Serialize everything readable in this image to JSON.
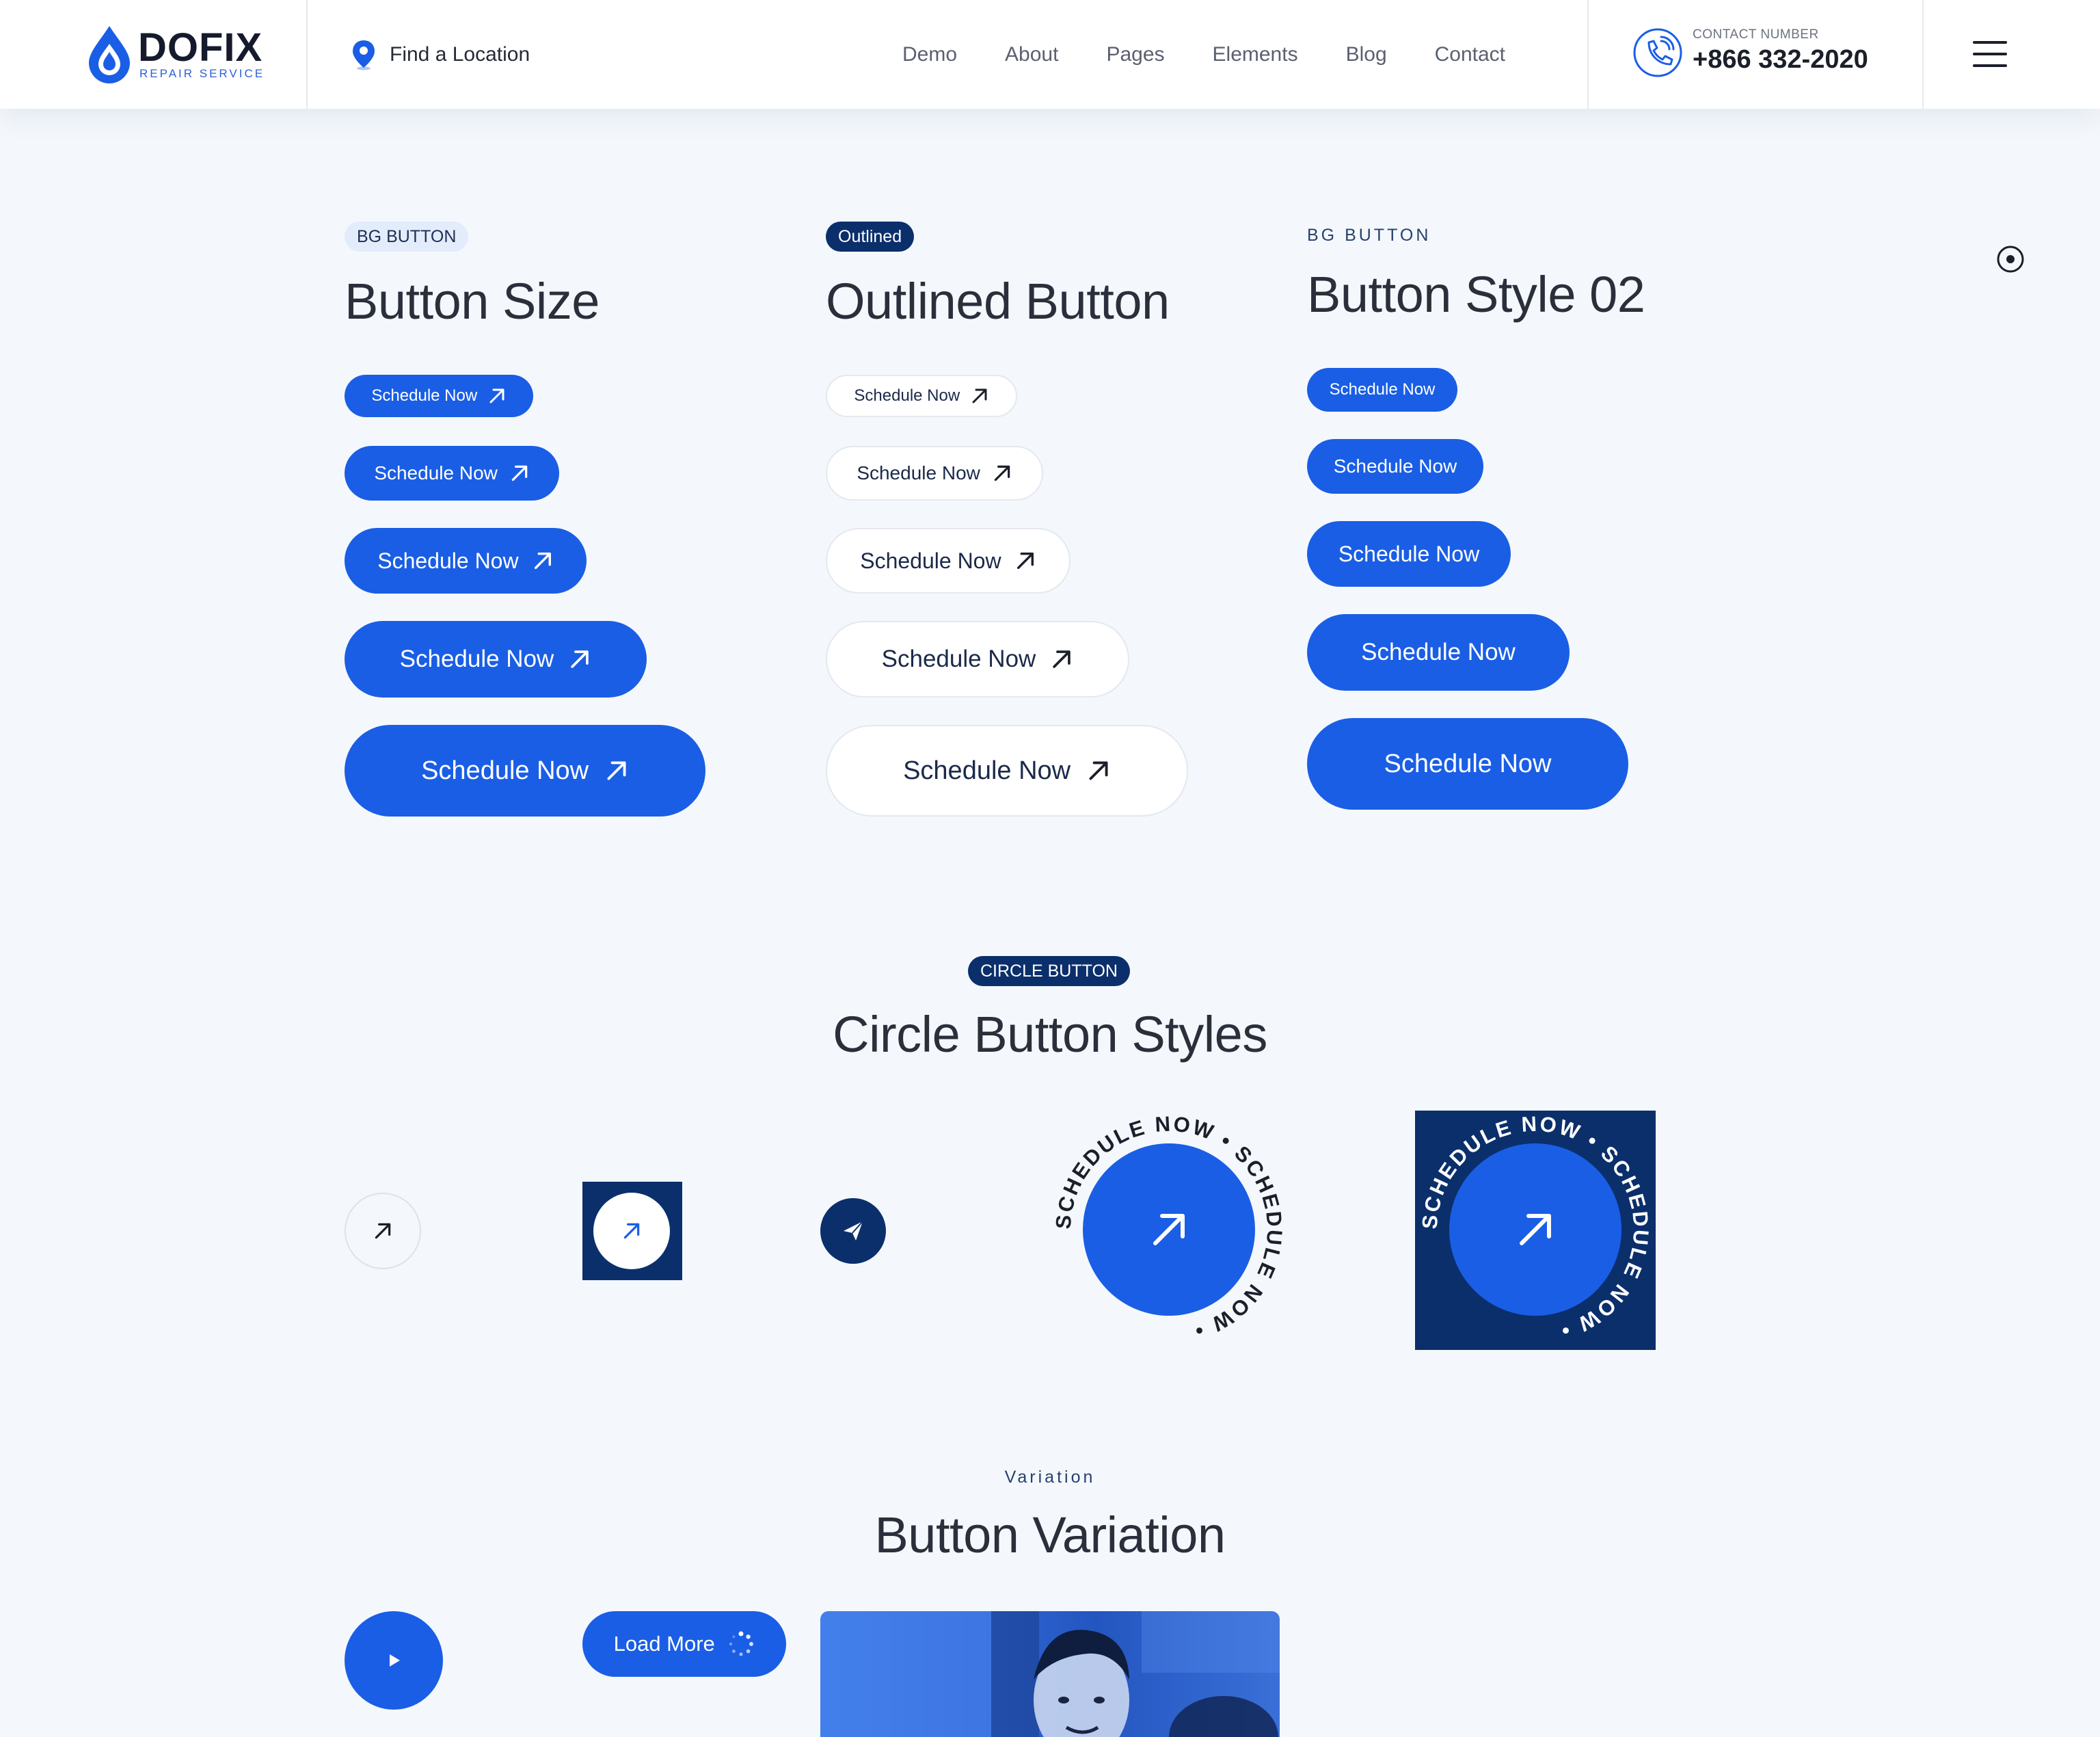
{
  "header": {
    "logo": {
      "name": "DOFIX",
      "tagline": "REPAIR SERVICE"
    },
    "location_label": "Find a Location",
    "nav": [
      "Demo",
      "About",
      "Pages",
      "Elements",
      "Blog",
      "Contact"
    ],
    "contact": {
      "label": "CONTACT NUMBER",
      "number": "+866 332-2020"
    }
  },
  "sections": {
    "button_size": {
      "tag": "BG BUTTON",
      "title": "Button Size"
    },
    "outlined": {
      "tag": "Outlined",
      "title": "Outlined Button"
    },
    "style02": {
      "tag": "BG BUTTON",
      "title": "Button Style 02"
    },
    "circle": {
      "tag": "CIRCLE BUTTON",
      "title": "Circle Button Styles"
    },
    "variation": {
      "tag": "Variation",
      "title": "Button Variation"
    }
  },
  "buttons": {
    "schedule_label": "Schedule Now",
    "load_more_label": "Load More",
    "circle_ring_text": "SCHEDULE NOW • SCHEDULE NOW • "
  },
  "colors": {
    "primary": "#1a5ee5",
    "navy": "#0b2f6b",
    "background": "#f4f8fc"
  },
  "icons": [
    "location-pin-icon",
    "phone-icon",
    "menu-icon",
    "arrow-up-right-icon",
    "paper-plane-icon",
    "play-icon",
    "spinner-icon",
    "radio-dot-icon"
  ]
}
